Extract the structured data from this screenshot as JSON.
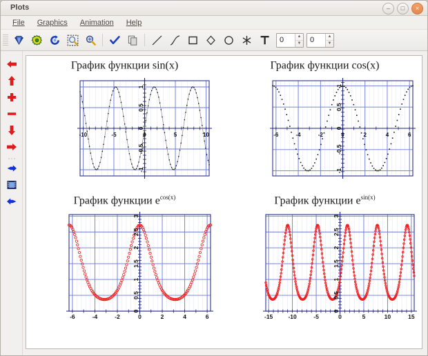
{
  "window": {
    "title": "Plots",
    "buttons": [
      {
        "name": "minimize",
        "glyph": "–"
      },
      {
        "name": "maximize",
        "glyph": "□"
      },
      {
        "name": "close",
        "glyph": "×"
      }
    ]
  },
  "menubar": {
    "items": [
      {
        "label": "File",
        "accel": "F"
      },
      {
        "label": "Graphics",
        "accel": "G"
      },
      {
        "label": "Animation",
        "accel": "A"
      },
      {
        "label": "Help",
        "accel": "H"
      }
    ]
  },
  "toolbar": {
    "icons": [
      {
        "name": "new-plot-icon",
        "kind": "diamond-blue"
      },
      {
        "name": "settings-gear-icon",
        "kind": "gear-green"
      },
      {
        "name": "refresh-icon",
        "kind": "refresh-blue"
      },
      {
        "name": "zoom-region-icon",
        "kind": "zoom-select"
      },
      {
        "name": "zoom-icon",
        "kind": "magnifier"
      },
      {
        "name": "apply-check-icon",
        "kind": "check-blue"
      },
      {
        "name": "copy-icon",
        "kind": "copy"
      },
      {
        "name": "line-tool-icon",
        "kind": "line"
      },
      {
        "name": "curve-tool-icon",
        "kind": "curve"
      },
      {
        "name": "rectangle-tool-icon",
        "kind": "rect"
      },
      {
        "name": "diamond-tool-icon",
        "kind": "diamond"
      },
      {
        "name": "ellipse-tool-icon",
        "kind": "circle"
      },
      {
        "name": "asterisk-tool-icon",
        "kind": "asterisk"
      },
      {
        "name": "text-tool-icon",
        "kind": "text"
      }
    ],
    "spinner_x": {
      "value": "0"
    },
    "spinner_y": {
      "value": "0"
    }
  },
  "sidebar": {
    "items": [
      {
        "name": "move-left-button",
        "kind": "arrow-left",
        "color": "#e01b1b"
      },
      {
        "name": "move-up-button",
        "kind": "arrow-up",
        "color": "#e01b1b"
      },
      {
        "name": "zoom-in-button",
        "kind": "plus",
        "color": "#e01b1b"
      },
      {
        "name": "zoom-out-button",
        "kind": "minus",
        "color": "#e01b1b"
      },
      {
        "name": "move-down-button",
        "kind": "arrow-down",
        "color": "#e01b1b"
      },
      {
        "name": "move-right-button",
        "kind": "arrow-right",
        "color": "#e01b1b"
      },
      {
        "name": "separator",
        "kind": "sep",
        "color": ""
      },
      {
        "name": "next-frame-button",
        "kind": "arrow-right",
        "color": "#1430d8"
      },
      {
        "name": "filmstrip-button",
        "kind": "film",
        "color": "#2a3f8f"
      },
      {
        "name": "prev-frame-button",
        "kind": "arrow-left",
        "color": "#1430d8"
      }
    ]
  },
  "colors": {
    "frame": "#2b2f8f",
    "grid": "#6a78d8",
    "minor_grid": "#b9c0ea",
    "curve_black": "#111111",
    "curve_red": "#ee2020",
    "axis": "#1b1f7a"
  },
  "chart_data": [
    {
      "id": "plot-sin",
      "type": "line",
      "title": "График функции sin(x)",
      "title_base": "График функции sin(x)",
      "title_sup": "",
      "function": "sin(x)",
      "marker": "dot-small",
      "color": "#111111",
      "xlabel": "",
      "ylabel": "",
      "xlim": [
        -10.5,
        10.5
      ],
      "ylim": [
        -1.15,
        1.15
      ],
      "xticks": [
        -10,
        -5,
        0,
        5,
        10
      ],
      "xticklabels": [
        "-10",
        "-5",
        "0",
        "5",
        "10"
      ],
      "yticks": [
        -1,
        -0.5,
        0,
        0.5,
        1
      ],
      "yticklabels": [
        "-1",
        "-0,5",
        "0",
        "0,5",
        "1"
      ],
      "grid": true,
      "n_points": 220
    },
    {
      "id": "plot-cos",
      "type": "scatter",
      "title": "График функции cos(x)",
      "title_base": "График функции cos(x)",
      "title_sup": "",
      "function": "cos(x)",
      "marker": "dot-sparse",
      "color": "#111111",
      "xlabel": "",
      "ylabel": "",
      "xlim": [
        -6.3,
        6.3
      ],
      "ylim": [
        -1.12,
        1.12
      ],
      "xticks": [
        -6,
        -4,
        -2,
        0,
        2,
        4,
        6
      ],
      "xticklabels": [
        "-6",
        "-4",
        "-2",
        "0",
        "2",
        "4",
        "6"
      ],
      "yticks": [
        -1,
        -0.5,
        0,
        0.5,
        1
      ],
      "yticklabels": [
        "-1",
        "-0,5",
        "0",
        "0,5",
        "1"
      ],
      "grid": true,
      "n_points": 90
    },
    {
      "id": "plot-exp-cos",
      "type": "scatter",
      "title": "График функции e^cos(x)",
      "title_base": "График функции e",
      "title_sup": "cos(x)",
      "function": "e^cos(x)",
      "marker": "circle-open",
      "color": "#ee2020",
      "xlabel": "",
      "ylabel": "",
      "xlim": [
        -6.3,
        6.3
      ],
      "ylim": [
        0,
        3.05
      ],
      "xticks": [
        -6,
        -4,
        -2,
        0,
        2,
        4,
        6
      ],
      "xticklabels": [
        "-6",
        "-4",
        "-2",
        "0",
        "2",
        "4",
        "6"
      ],
      "yticks": [
        0,
        0.5,
        1,
        1.5,
        2,
        2.5,
        3
      ],
      "yticklabels": [
        "0",
        "0,5",
        "1",
        "1,5",
        "2",
        "2,5",
        "3"
      ],
      "grid": true,
      "n_points": 150
    },
    {
      "id": "plot-exp-sin",
      "type": "scatter",
      "title": "График функции e^sin(x)",
      "title_base": "График функции e",
      "title_sup": "sin(x)",
      "function": "e^sin(x)",
      "marker": "circle-open",
      "color": "#ee2020",
      "xlabel": "",
      "ylabel": "",
      "xlim": [
        -15.6,
        15.6
      ],
      "ylim": [
        0,
        3.05
      ],
      "xticks": [
        -15,
        -10,
        -5,
        0,
        5,
        10,
        15
      ],
      "xticklabels": [
        "-15",
        "-10",
        "-5",
        "0",
        "5",
        "10",
        "15"
      ],
      "yticks": [
        0,
        0.5,
        1,
        1.5,
        2,
        2.5,
        3
      ],
      "yticklabels": [
        "0",
        "0,5",
        "1",
        "1,5",
        "2",
        "2,5",
        "3"
      ],
      "grid": true,
      "n_points": 330
    }
  ]
}
